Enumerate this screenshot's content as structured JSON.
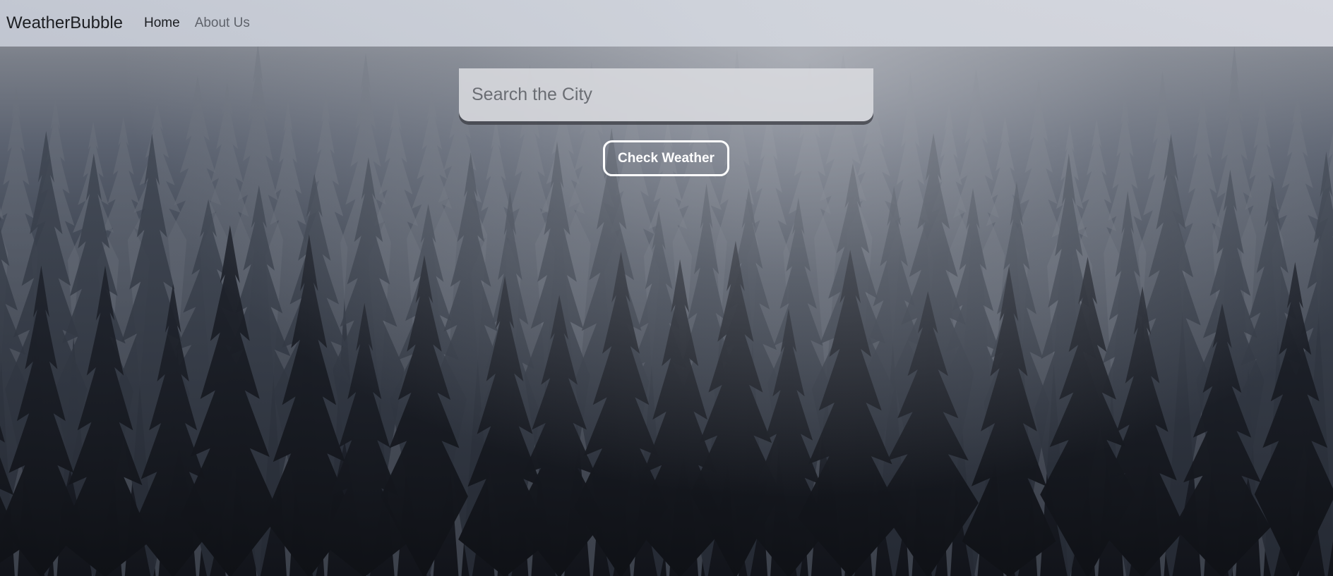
{
  "navbar": {
    "brand": "WeatherBubble",
    "links": [
      {
        "label": "Home",
        "active": true
      },
      {
        "label": "About Us",
        "active": false
      }
    ]
  },
  "search": {
    "placeholder": "Search the City",
    "value": ""
  },
  "actions": {
    "check_weather_label": "Check Weather"
  },
  "background": {
    "description_icon": "foggy-forest-image"
  }
}
